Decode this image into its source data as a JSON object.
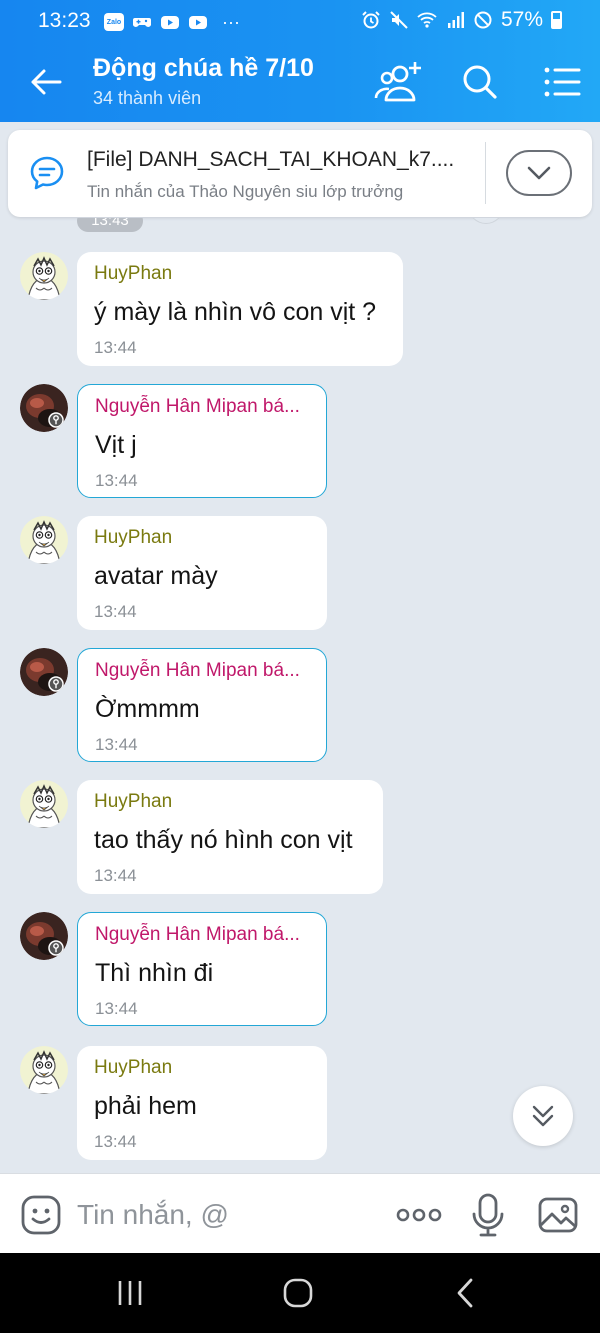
{
  "status_bar": {
    "time": "13:23",
    "app_icons": [
      "Zalo",
      "gamepad",
      "youtube",
      "youtube"
    ],
    "more": "···",
    "battery": "57%"
  },
  "header": {
    "title": "Động chúa hề 7/10",
    "subtitle": "34 thành viên",
    "icons": [
      "back-arrow-icon",
      "add-member-icon",
      "search-icon",
      "menu-list-icon"
    ],
    "accent_color": "#1a8ff2"
  },
  "pinned": {
    "title": "[File] DANH_SACH_TAI_KHOAN_k7....",
    "subtitle": "Tin nhắn của Thảo Nguyên siu lớp trưởng"
  },
  "chat": {
    "top_time": "13:43",
    "messages": [
      {
        "sender": "HuyPhan",
        "text": "ý mày là nhìn vô con vịt ?",
        "time": "13:44"
      },
      {
        "sender": "Nguyễn Hân Mipan bá...",
        "text": "Vịt j",
        "time": "13:44"
      },
      {
        "sender": "HuyPhan",
        "text": "avatar mày",
        "time": "13:44"
      },
      {
        "sender": "Nguyễn Hân Mipan bá...",
        "text": "Ờmmmm",
        "time": "13:44"
      },
      {
        "sender": "HuyPhan",
        "text": "tao thấy nó hình con vịt",
        "time": "13:44"
      },
      {
        "sender": "Nguyễn Hân Mipan bá...",
        "text": "Thì nhìn đi",
        "time": "13:44"
      },
      {
        "sender": "HuyPhan",
        "text": "phải hem",
        "time": "13:44"
      }
    ]
  },
  "input": {
    "placeholder": "Tin nhắn, @"
  }
}
